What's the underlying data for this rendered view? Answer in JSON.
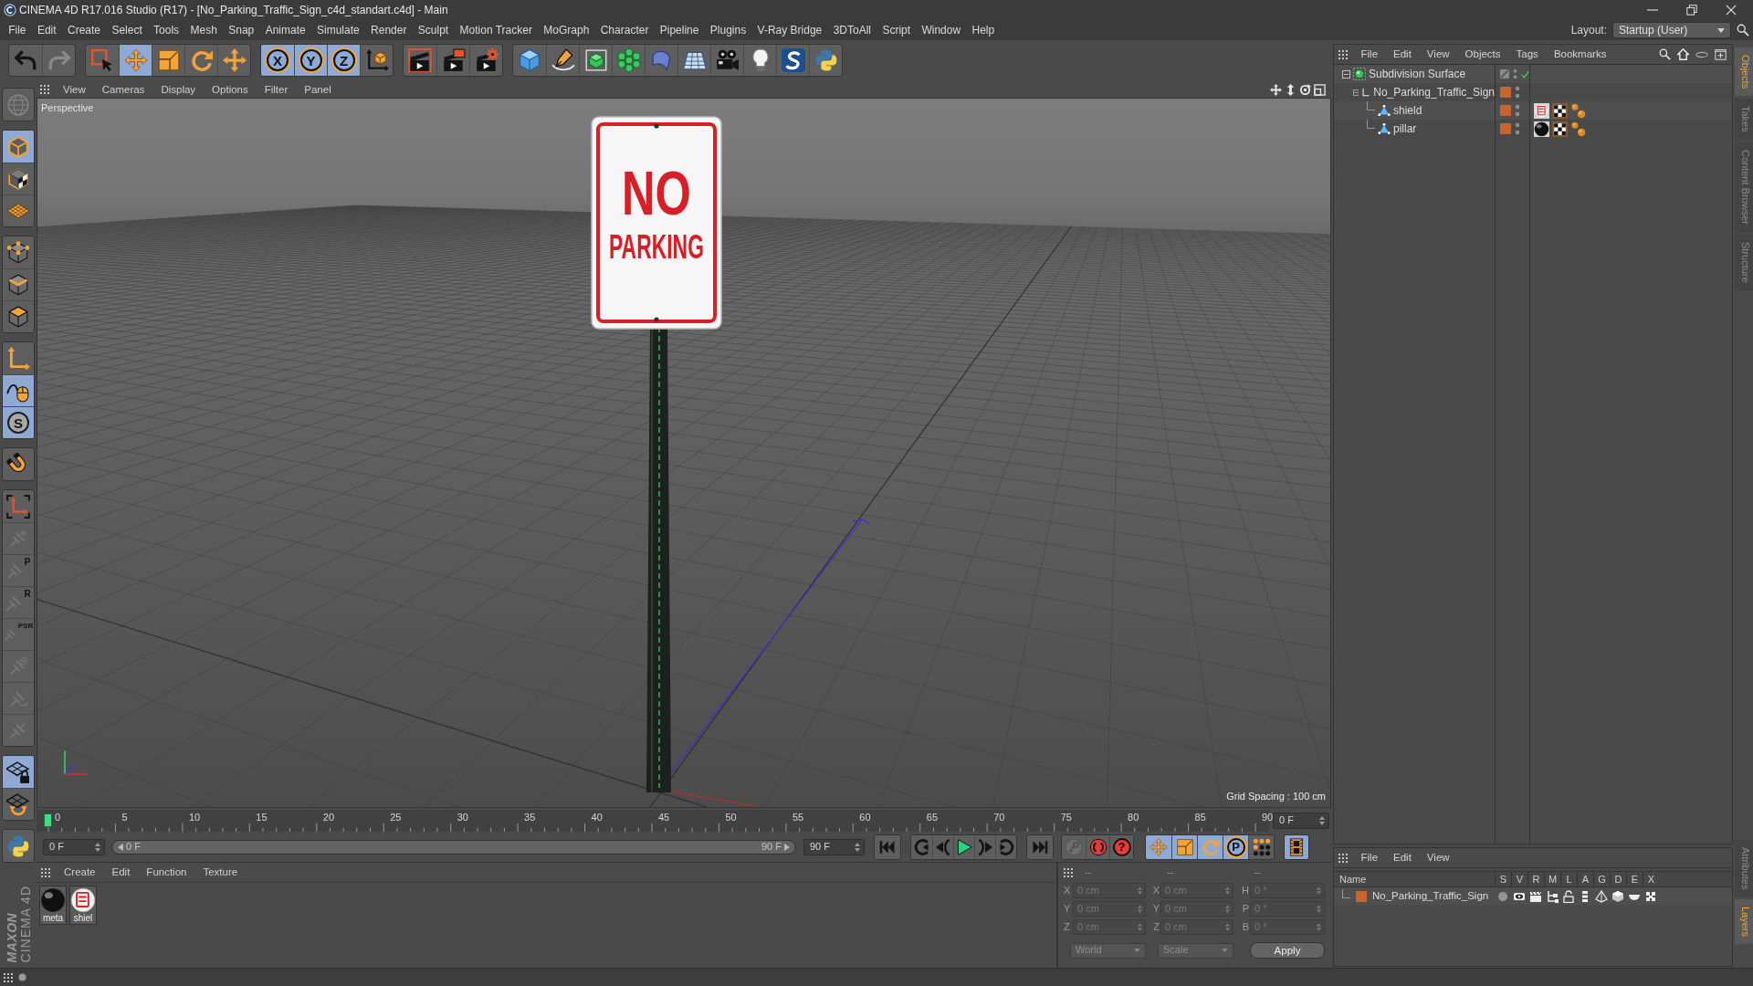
{
  "window": {
    "title": "CINEMA 4D R17.016 Studio (R17) - [No_Parking_Traffic_Sign_c4d_standart.c4d] - Main"
  },
  "menu": [
    "File",
    "Edit",
    "Create",
    "Select",
    "Tools",
    "Mesh",
    "Snap",
    "Animate",
    "Simulate",
    "Render",
    "Sculpt",
    "Motion Tracker",
    "MoGraph",
    "Character",
    "Pipeline",
    "Plugins",
    "V-Ray Bridge",
    "3DToAll",
    "Script",
    "Window",
    "Help"
  ],
  "layout": {
    "label": "Layout:",
    "value": "Startup (User)"
  },
  "toolbar": [
    {
      "items": [
        {
          "kind": "undo",
          "selected": false,
          "disabled": false
        },
        {
          "kind": "redo",
          "selected": false,
          "disabled": true
        }
      ]
    },
    {
      "items": [
        {
          "kind": "live-select",
          "selected": false,
          "disabled": false
        },
        {
          "kind": "move",
          "selected": true,
          "disabled": false
        },
        {
          "kind": "scale",
          "selected": false,
          "disabled": false
        },
        {
          "kind": "rotate",
          "selected": false,
          "disabled": false
        },
        {
          "kind": "recent-tool",
          "selected": false,
          "disabled": false
        }
      ]
    },
    {
      "items": [
        {
          "kind": "x-axis",
          "label": "X",
          "selected": true,
          "disabled": false
        },
        {
          "kind": "y-axis",
          "label": "Y",
          "selected": true,
          "disabled": false
        },
        {
          "kind": "z-axis",
          "label": "Z",
          "selected": true,
          "disabled": false
        },
        {
          "kind": "coordinate-system",
          "selected": false,
          "disabled": false
        }
      ]
    },
    {
      "items": [
        {
          "kind": "render-view",
          "selected": false,
          "disabled": false
        },
        {
          "kind": "render-to-viewer",
          "selected": false,
          "disabled": false
        },
        {
          "kind": "render-settings",
          "selected": false,
          "disabled": false
        }
      ]
    },
    {
      "items": [
        {
          "kind": "cube",
          "selected": false,
          "disabled": false
        },
        {
          "kind": "pen",
          "selected": false,
          "disabled": false
        },
        {
          "kind": "subdivision",
          "selected": false,
          "disabled": false
        },
        {
          "kind": "cloner",
          "selected": false,
          "disabled": false
        },
        {
          "kind": "bend",
          "selected": false,
          "disabled": false
        },
        {
          "kind": "floor",
          "selected": false,
          "disabled": false
        },
        {
          "kind": "camera",
          "selected": false,
          "disabled": false
        },
        {
          "kind": "light",
          "selected": false,
          "disabled": false
        },
        {
          "kind": "s-logo",
          "selected": false,
          "disabled": false
        },
        {
          "kind": "python",
          "selected": false,
          "disabled": false
        }
      ]
    }
  ],
  "palette": [
    {
      "items": [
        {
          "kind": "globe",
          "selected": false,
          "disabled": true
        }
      ]
    },
    {
      "items": [
        {
          "kind": "model",
          "selected": true,
          "disabled": false
        },
        {
          "kind": "texture",
          "selected": false,
          "disabled": false
        },
        {
          "kind": "workplane",
          "selected": false,
          "disabled": false
        }
      ]
    },
    {
      "items": [
        {
          "kind": "points",
          "selected": false,
          "disabled": false
        },
        {
          "kind": "edges",
          "selected": false,
          "disabled": false
        },
        {
          "kind": "polygons",
          "selected": false,
          "disabled": false
        }
      ]
    },
    {
      "items": [
        {
          "kind": "axis",
          "selected": false,
          "disabled": false
        },
        {
          "kind": "tweak",
          "selected": true,
          "disabled": false
        },
        {
          "kind": "solo",
          "label": "S",
          "selected": true,
          "disabled": false
        }
      ]
    },
    {
      "items": [
        {
          "kind": "magnet",
          "selected": false,
          "disabled": false
        }
      ]
    },
    {
      "items": [
        {
          "kind": "axis-snap",
          "selected": false,
          "disabled": false
        },
        {
          "kind": "pin-add",
          "selected": false,
          "disabled": true
        },
        {
          "kind": "pin-position",
          "label": "P",
          "selected": false,
          "disabled": true
        },
        {
          "kind": "pin-rotation",
          "label": "R",
          "selected": false,
          "disabled": true
        },
        {
          "kind": "pin-psr",
          "label": "PSR",
          "selected": false,
          "disabled": true
        },
        {
          "kind": "pin-target",
          "selected": false,
          "disabled": true
        },
        {
          "kind": "pin-clip",
          "selected": false,
          "disabled": true
        },
        {
          "kind": "pin-edit",
          "selected": false,
          "disabled": true
        }
      ]
    },
    {
      "items": [
        {
          "kind": "grid-lock",
          "selected": true,
          "disabled": false
        },
        {
          "kind": "grid-rotate",
          "selected": false,
          "disabled": false
        }
      ]
    },
    {
      "items": [
        {
          "kind": "python",
          "selected": false,
          "disabled": false
        }
      ]
    }
  ],
  "logo": [
    "MAXON",
    "CINEMA 4D"
  ],
  "viewport": {
    "menu": [
      "View",
      "Cameras",
      "Display",
      "Options",
      "Filter",
      "Panel"
    ],
    "camera": "Perspective",
    "sign": [
      "NO",
      "PARKING"
    ],
    "grid_spacing": "Grid Spacing : 100 cm"
  },
  "timeline": {
    "ticks": [
      "0",
      "5",
      "10",
      "15",
      "20",
      "25",
      "30",
      "35",
      "40",
      "45",
      "50",
      "55",
      "60",
      "65",
      "70",
      "75",
      "80",
      "85",
      "90"
    ],
    "playhead": {
      "level": 0
    },
    "current_frame": "0 F"
  },
  "transport": {
    "start_field": "0 F",
    "range": {
      "start": "0 F",
      "end": "90 F",
      "level": 1
    },
    "end_field": "90 F",
    "groups": [
      {
        "items": [
          {
            "kind": "go-start",
            "selected": false,
            "disabled": false
          }
        ]
      },
      {
        "items": [
          {
            "kind": "prev-key",
            "selected": false,
            "disabled": false
          },
          {
            "kind": "prev-frame",
            "selected": false,
            "disabled": false
          },
          {
            "kind": "play",
            "selected": false,
            "disabled": false
          },
          {
            "kind": "next-frame",
            "selected": false,
            "disabled": false
          },
          {
            "kind": "next-key",
            "selected": false,
            "disabled": false
          }
        ]
      },
      {
        "items": [
          {
            "kind": "go-end",
            "selected": false,
            "disabled": false
          }
        ]
      },
      {
        "items": [
          {
            "kind": "record-key",
            "selected": false,
            "disabled": true
          },
          {
            "kind": "autokey",
            "selected": false,
            "disabled": false
          },
          {
            "kind": "keyframe-selection",
            "label": "?",
            "selected": false,
            "disabled": false
          }
        ]
      },
      {
        "items": [
          {
            "kind": "key-move",
            "selected": true,
            "disabled": false
          },
          {
            "kind": "key-scale",
            "selected": true,
            "disabled": false
          },
          {
            "kind": "key-rotate",
            "selected": true,
            "disabled": false
          },
          {
            "kind": "key-param",
            "label": "P",
            "selected": true,
            "disabled": false
          },
          {
            "kind": "key-points",
            "selected": false,
            "disabled": false
          }
        ]
      },
      {
        "items": [
          {
            "kind": "film",
            "selected": true,
            "disabled": false
          }
        ]
      }
    ]
  },
  "materials": {
    "menu": [
      "Create",
      "Edit",
      "Function",
      "Texture"
    ],
    "items": [
      {
        "name": "meta",
        "kind": "black"
      },
      {
        "name": "shiel",
        "kind": "sign"
      }
    ]
  },
  "coordinates": {
    "disabled": true,
    "headers": [
      "--",
      "--",
      "--"
    ],
    "rows": [
      {
        "labels": [
          "X",
          "X",
          "H"
        ],
        "values": [
          "0 cm",
          "0 cm",
          "0 °"
        ]
      },
      {
        "labels": [
          "Y",
          "Y",
          "P"
        ],
        "values": [
          "0 cm",
          "0 cm",
          "0 °"
        ]
      },
      {
        "labels": [
          "Z",
          "Z",
          "B"
        ],
        "values": [
          "0 cm",
          "0 cm",
          "0 °"
        ]
      }
    ],
    "modes": [
      "World",
      "Scale"
    ],
    "apply": "Apply"
  },
  "objects": {
    "menu": [
      "File",
      "Edit",
      "View",
      "Objects",
      "Tags",
      "Bookmarks"
    ],
    "tree": [
      {
        "name": "Subdivision Surface",
        "kind": "subdivision",
        "enabled": true,
        "selected": false,
        "children": [
          {
            "name": "No_Parking_Traffic_Sign",
            "kind": "null",
            "color": "#c8642e",
            "selected": false,
            "children": [
              {
                "name": "shield",
                "kind": "polygon",
                "color": "#c8642e",
                "selected": false,
                "tags": [
                  {
                    "kind": "sign-material"
                  },
                  {
                    "kind": "uvw"
                  },
                  {
                    "kind": "balls"
                  }
                ]
              },
              {
                "name": "pillar",
                "kind": "polygon",
                "color": "#c8642e",
                "selected": false,
                "tags": [
                  {
                    "kind": "black-material"
                  },
                  {
                    "kind": "uvw"
                  },
                  {
                    "kind": "balls"
                  }
                ]
              }
            ]
          }
        ]
      }
    ]
  },
  "object_tabs": [
    {
      "label": "Objects",
      "selected": true
    },
    {
      "label": "Takes",
      "selected": false
    },
    {
      "label": "Content Browser",
      "selected": false
    },
    {
      "label": "Structure",
      "selected": false
    }
  ],
  "layers": {
    "menu": [
      "File",
      "Edit",
      "View"
    ],
    "columns": [
      "Name",
      "S",
      "V",
      "R",
      "M",
      "L",
      "A",
      "G",
      "D",
      "E",
      "X"
    ],
    "rows": [
      {
        "name": "No_Parking_Traffic_Sign",
        "color": "#c8642e",
        "flags": [
          {
            "kind": "solo",
            "on": false
          },
          {
            "kind": "visible",
            "on": true
          },
          {
            "kind": "render",
            "on": true
          },
          {
            "kind": "manager",
            "on": true
          },
          {
            "kind": "locked",
            "on": true
          },
          {
            "kind": "animation",
            "on": true
          },
          {
            "kind": "generators",
            "on": true
          },
          {
            "kind": "deformers",
            "on": true
          },
          {
            "kind": "expressions",
            "on": true
          },
          {
            "kind": "xpresso",
            "on": true
          }
        ]
      }
    ]
  },
  "layer_tabs": [
    {
      "label": "Attributes",
      "selected": false
    },
    {
      "label": "Layers",
      "selected": true
    }
  ]
}
